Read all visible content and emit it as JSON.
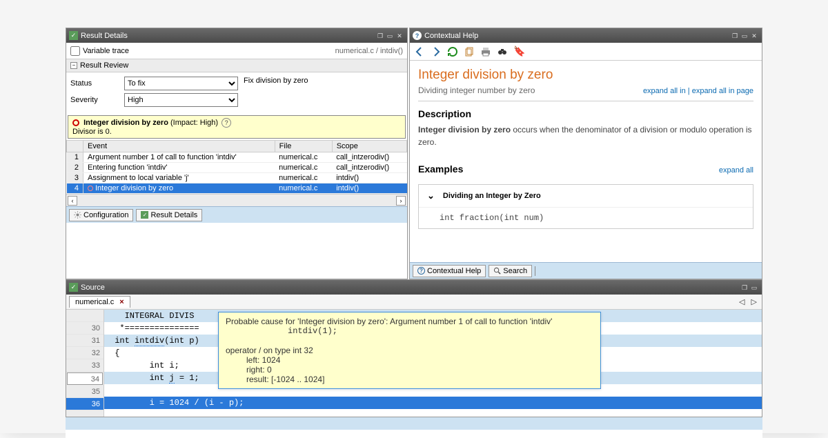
{
  "result_details": {
    "title": "Result Details",
    "variable_trace_label": "Variable trace",
    "breadcrumb": "numerical.c / intdiv()",
    "result_review_label": "Result Review",
    "status_label": "Status",
    "status_value": "To fix",
    "severity_label": "Severity",
    "severity_value": "High",
    "comment_value": "Fix division by zero",
    "alert_title": "Integer division by zero",
    "alert_impact": "(Impact: High)",
    "alert_detail": "Divisor is 0.",
    "columns": {
      "event": "Event",
      "file": "File",
      "scope": "Scope"
    },
    "events": [
      {
        "n": "1",
        "event": "Argument number 1 of call to function 'intdiv'",
        "file": "numerical.c",
        "scope": "call_intzerodiv()"
      },
      {
        "n": "2",
        "event": "Entering function 'intdiv'",
        "file": "numerical.c",
        "scope": "call_intzerodiv()"
      },
      {
        "n": "3",
        "event": "Assignment to local variable 'j'",
        "file": "numerical.c",
        "scope": "intdiv()"
      },
      {
        "n": "4",
        "event": "Integer division by zero",
        "file": "numerical.c",
        "scope": "intdiv()"
      }
    ]
  },
  "tabs_left": {
    "config": "Configuration",
    "details": "Result Details"
  },
  "tabs_right": {
    "help": "Contextual Help",
    "search": "Search"
  },
  "help": {
    "title": "Contextual Help",
    "page_title": "Integer division by zero",
    "subtitle": "Dividing integer number by zero",
    "expand_all_in": "expand all in",
    "expand_all_page": "expand all in page",
    "desc_hdr": "Description",
    "desc_body_prefix": "Integer division by zero",
    "desc_body": " occurs when the denominator of a division or modulo operation is zero.",
    "examples_hdr": "Examples",
    "expand_all": "expand all",
    "example_title": "Dividing an Integer by Zero",
    "example_code": "int fraction(int num)"
  },
  "source": {
    "title": "Source",
    "tab": "numerical.c",
    "lines": [
      {
        "n": "",
        "text": "   INTEGRAL DIVIS"
      },
      {
        "n": "30",
        "text": "  *==============="
      },
      {
        "n": "31",
        "text": " int intdiv(int p)"
      },
      {
        "n": "32",
        "text": " {"
      },
      {
        "n": "33",
        "text": "        int i;"
      },
      {
        "n": "34",
        "text": "        int j = 1;"
      },
      {
        "n": "35",
        "text": ""
      },
      {
        "n": "36",
        "text": "        i = 1024 / (i - p);"
      }
    ]
  },
  "tooltip": {
    "line1": "Probable cause for 'Integer division by zero': Argument number 1 of call to function 'intdiv'",
    "line2": "intdiv(1);",
    "line3": "operator / on type int 32",
    "line4": "left:  1024",
    "line5": "right:  0",
    "line6": "result: [-1024 .. 1024]"
  }
}
